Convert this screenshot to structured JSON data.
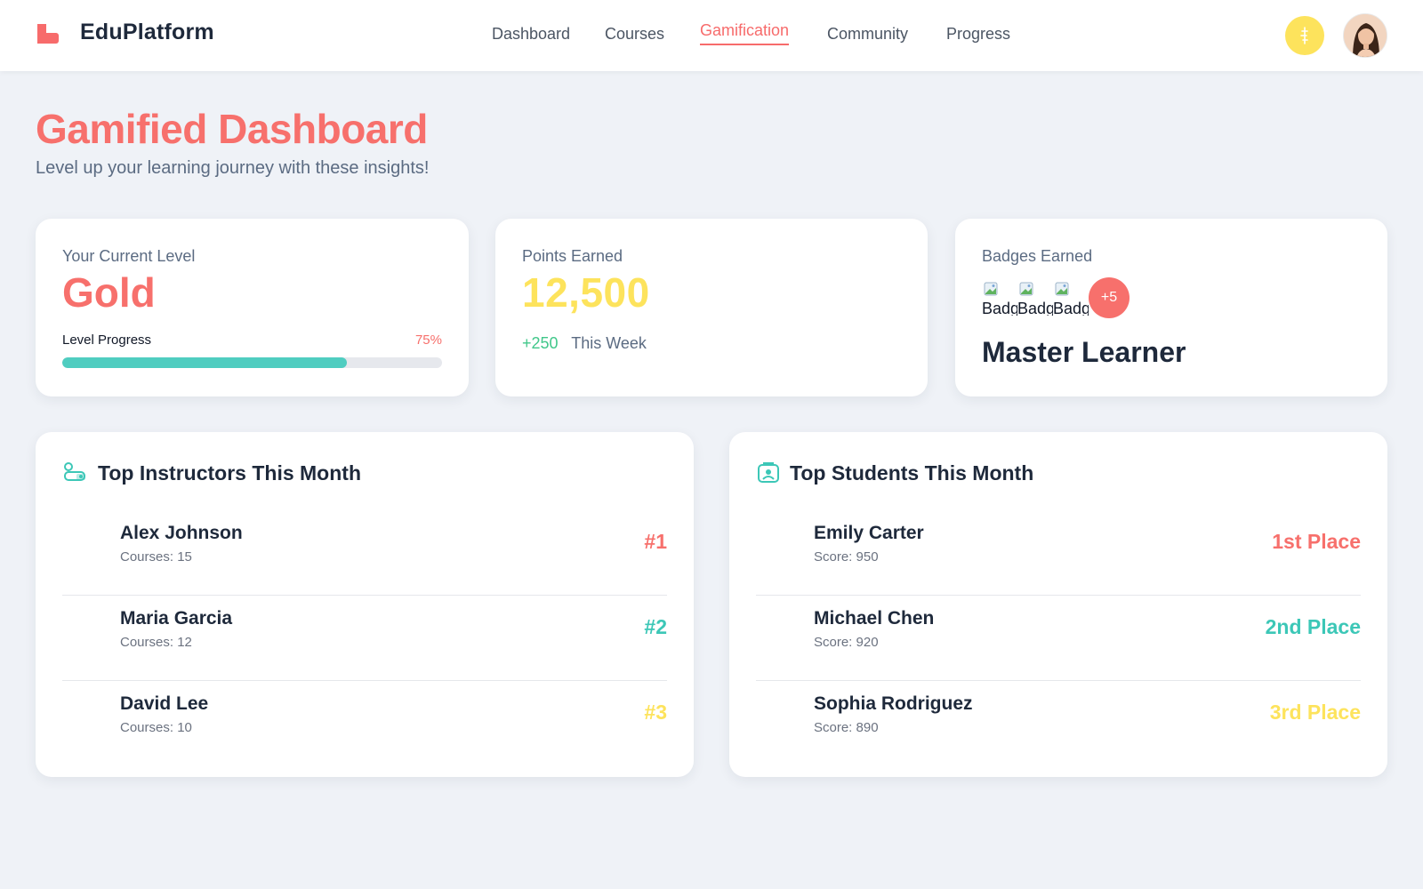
{
  "brand": {
    "name": "EduPlatform"
  },
  "nav": {
    "items": [
      {
        "label": "Dashboard"
      },
      {
        "label": "Courses"
      },
      {
        "label": "Gamification"
      },
      {
        "label": "Community"
      },
      {
        "label": "Progress"
      }
    ],
    "active": "Gamification"
  },
  "header_icons": {
    "coin": "coin-icon",
    "avatar": "user-avatar"
  },
  "page": {
    "title": "Gamified Dashboard",
    "subtitle": "Level up your learning journey with these insights!"
  },
  "level_card": {
    "label": "Your Current Level",
    "value": "Gold",
    "progress_label": "Level Progress",
    "progress_text": "75%",
    "progress_fraction": 0.75
  },
  "points_card": {
    "label": "Points Earned",
    "value": "12,500",
    "delta": "+250",
    "delta_period": "This Week"
  },
  "badges_card": {
    "label": "Badges Earned",
    "badge_alt": [
      "Badge",
      "Badge",
      "Badge"
    ],
    "more": "+5",
    "title": "Master Learner"
  },
  "instructors": {
    "title": "Top Instructors This Month",
    "icon": "instructor-icon",
    "rows": [
      {
        "name": "Alex Johnson",
        "meta": "Courses: 15",
        "rank": "#1"
      },
      {
        "name": "Maria Garcia",
        "meta": "Courses: 12",
        "rank": "#2"
      },
      {
        "name": "David Lee",
        "meta": "Courses: 10",
        "rank": "#3"
      }
    ]
  },
  "students": {
    "title": "Top Students This Month",
    "icon": "student-icon",
    "rows": [
      {
        "name": "Emily Carter",
        "meta": "Score: 950",
        "rank": "1st Place"
      },
      {
        "name": "Michael Chen",
        "meta": "Score: 920",
        "rank": "2nd Place"
      },
      {
        "name": "Sophia Rodriguez",
        "meta": "Score: 890",
        "rank": "3rd Place"
      }
    ]
  },
  "colors": {
    "accent": "#f7706c",
    "teal": "#4fcdc0",
    "yellow": "#fde35c",
    "green": "#41c78a",
    "rank_colors": [
      "#f7706c",
      "#3cc7b7",
      "#fde35c"
    ]
  }
}
